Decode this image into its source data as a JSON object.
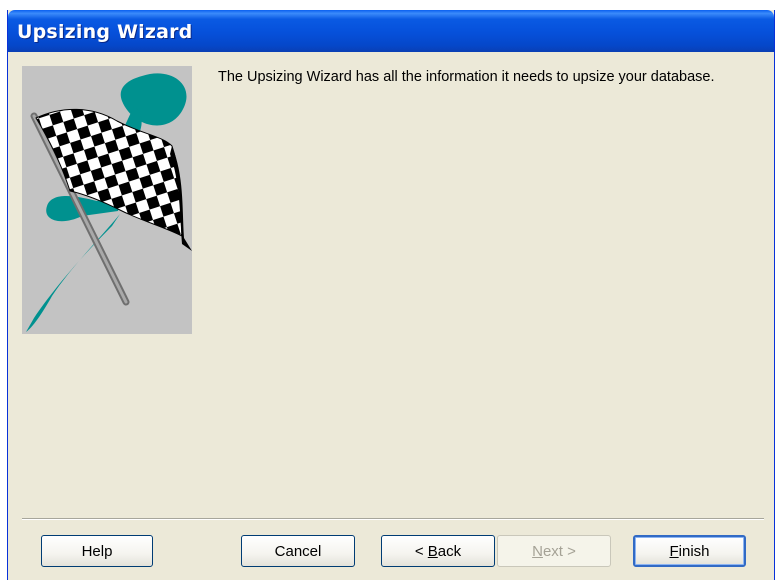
{
  "window": {
    "title": "Upsizing Wizard"
  },
  "content": {
    "message": "The Upsizing Wizard has all the information it needs to upsize your database."
  },
  "buttons": {
    "help": "Help",
    "cancel": "Cancel",
    "back_prefix": "< ",
    "back_accel": "B",
    "back_rest": "ack",
    "next_accel": "N",
    "next_rest": "ext >",
    "finish_accel": "F",
    "finish_rest": "inish"
  },
  "illustration": {
    "icon": "checkered-flag-icon",
    "colors": {
      "background": "#c3c3c3",
      "swoosh": "#00918f",
      "pole": "#8a8a8a"
    }
  },
  "colors": {
    "titlebar": "#0650da",
    "dialog_bg": "#ece9d8",
    "default_button_border": "#316ac5"
  }
}
